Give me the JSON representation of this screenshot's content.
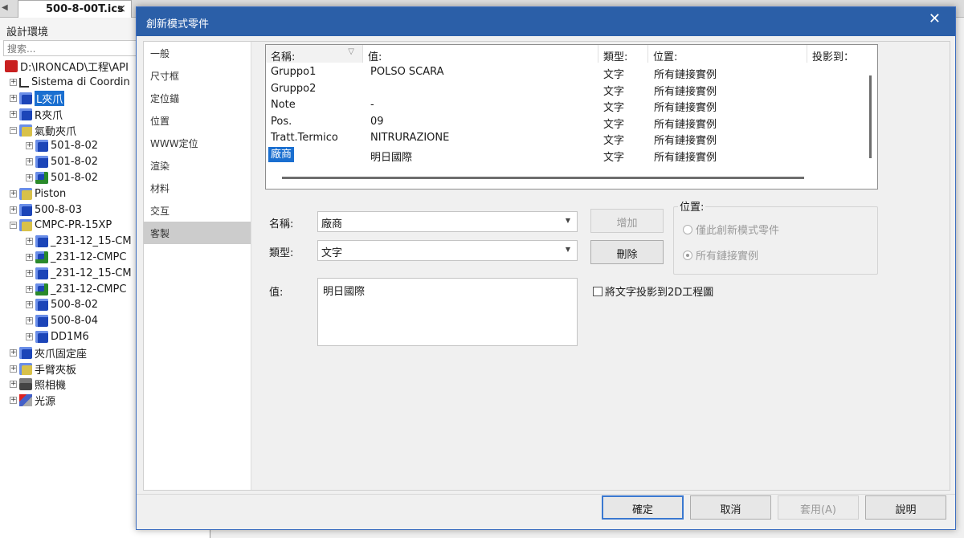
{
  "tabs": {
    "doc_tab": "500-8-00T.ics",
    "close": "×"
  },
  "left": {
    "title": "設計環境",
    "search_placeholder": "搜索...",
    "tree": [
      {
        "label": "D:\\IRONCAD\\工程\\API",
        "icon": "root-icon",
        "level": 0,
        "exp": ""
      },
      {
        "label": "Sistema di Coordin",
        "icon": "axis-icon",
        "level": 1,
        "exp": "+"
      },
      {
        "label": "L夾爪",
        "icon": "part-icon",
        "level": 1,
        "exp": "+",
        "selected": true
      },
      {
        "label": "R夾爪",
        "icon": "part-icon",
        "level": 1,
        "exp": "+"
      },
      {
        "label": "氣動夾爪",
        "icon": "assembly-icon",
        "level": 1,
        "exp": "−"
      },
      {
        "label": "501-8-02",
        "icon": "part-icon",
        "level": 2,
        "exp": "+"
      },
      {
        "label": "501-8-02",
        "icon": "part-icon",
        "level": 2,
        "exp": "+"
      },
      {
        "label": "501-8-02",
        "icon": "part-lock-icon",
        "level": 2,
        "exp": "+"
      },
      {
        "label": "Piston",
        "icon": "assembly-icon",
        "level": 1,
        "exp": "+"
      },
      {
        "label": "500-8-03",
        "icon": "part-icon",
        "level": 1,
        "exp": "+"
      },
      {
        "label": "CMPC-PR-15XP",
        "icon": "assembly-icon",
        "level": 1,
        "exp": "−"
      },
      {
        "label": "_231-12_15-CM",
        "icon": "part-icon",
        "level": 2,
        "exp": "+"
      },
      {
        "label": "_231-12-CMPC",
        "icon": "part-lock-icon",
        "level": 2,
        "exp": "+"
      },
      {
        "label": "_231-12_15-CM",
        "icon": "part-icon",
        "level": 2,
        "exp": "+"
      },
      {
        "label": "_231-12-CMPC",
        "icon": "part-lock-icon",
        "level": 2,
        "exp": "+"
      },
      {
        "label": "500-8-02",
        "icon": "part-icon",
        "level": 2,
        "exp": "+"
      },
      {
        "label": "500-8-04",
        "icon": "part-icon",
        "level": 2,
        "exp": "+"
      },
      {
        "label": "DD1M6",
        "icon": "part-icon",
        "level": 2,
        "exp": "+"
      },
      {
        "label": "夾爪固定座",
        "icon": "part-icon",
        "level": 1,
        "exp": "+"
      },
      {
        "label": "手臂夾板",
        "icon": "assembly-icon",
        "level": 1,
        "exp": "+"
      },
      {
        "label": "照相機",
        "icon": "camera-icon",
        "level": 1,
        "exp": "+"
      },
      {
        "label": "光源",
        "icon": "light-icon",
        "level": 1,
        "exp": "+"
      }
    ]
  },
  "dialog": {
    "title": "創新模式零件",
    "close": "✕",
    "nav": [
      {
        "label": "一般"
      },
      {
        "label": "尺寸框"
      },
      {
        "label": "定位錨"
      },
      {
        "label": "位置"
      },
      {
        "label": "WWW定位"
      },
      {
        "label": "渲染"
      },
      {
        "label": "材料"
      },
      {
        "label": "交互"
      },
      {
        "label": "客製",
        "selected": true
      }
    ],
    "grid": {
      "headers": [
        "名稱:",
        "值:",
        "類型:",
        "位置:",
        "投影到："
      ],
      "sort_icon": "▽",
      "rows": [
        {
          "name": "Gruppo1",
          "value": "POLSO SCARA",
          "type": "文字",
          "loc": "所有鏈接實例",
          "proj": ""
        },
        {
          "name": "Gruppo2",
          "value": "",
          "type": "文字",
          "loc": "所有鏈接實例",
          "proj": ""
        },
        {
          "name": "Note",
          "value": "-",
          "type": "文字",
          "loc": "所有鏈接實例",
          "proj": ""
        },
        {
          "name": "Pos.",
          "value": "09",
          "type": "文字",
          "loc": "所有鏈接實例",
          "proj": ""
        },
        {
          "name": "Tratt.Termico",
          "value": "NITRURAZIONE",
          "type": "文字",
          "loc": "所有鏈接實例",
          "proj": ""
        },
        {
          "name": "廠商",
          "value": "明日國際",
          "type": "文字",
          "loc": "所有鏈接實例",
          "proj": "",
          "selected": true
        }
      ]
    },
    "form": {
      "name_label": "名稱:",
      "name_value": "廠商",
      "type_label": "類型:",
      "type_value": "文字",
      "value_label": "值:",
      "value_text": "明日國際",
      "add_button": "增加",
      "delete_button": "刪除",
      "location_group": "位置:",
      "radio_this": "僅此創新模式零件",
      "radio_all": "所有鏈接實例",
      "project_checkbox": "將文字投影到2D工程圖"
    },
    "footer": {
      "ok": "確定",
      "cancel": "取消",
      "apply": "套用(A)",
      "help": "說明"
    }
  }
}
